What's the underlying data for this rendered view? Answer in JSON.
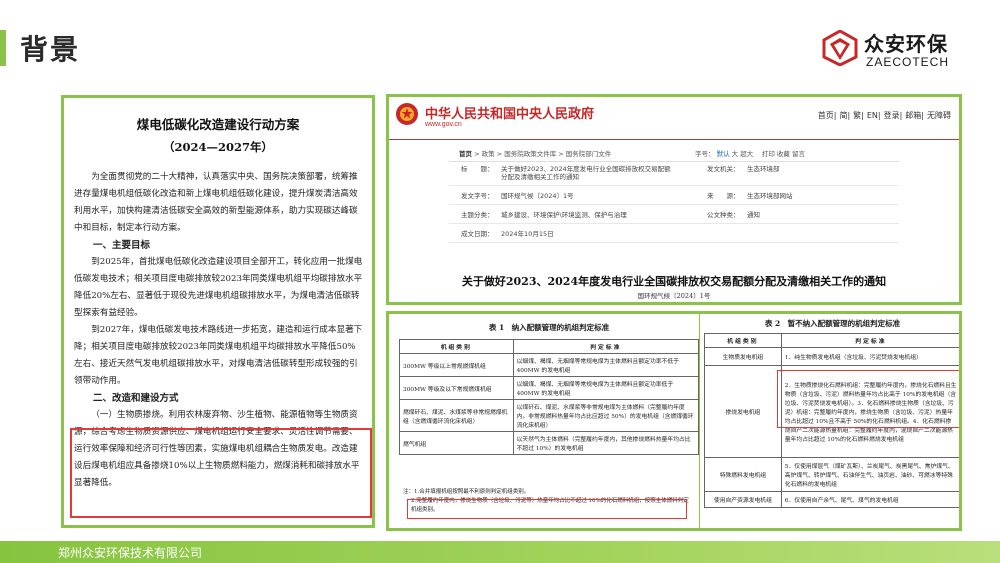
{
  "header": {
    "title": "背景",
    "logo_cn": "众安环保",
    "logo_en": "ZAECOTECH"
  },
  "footer": {
    "company": "郑州众安环保技术有限公司"
  },
  "colors": {
    "accent_green": "#8bc34a",
    "highlight_red": "#e53935",
    "gov_red": "#c62828"
  },
  "doc": {
    "title": "煤电低碳化改造建设行动方案",
    "subtitle": "（2024—2027年）",
    "para1": "为全面贯彻党的二十大精神，认真落实中央、国务院决策部署，统筹推进存量煤电机组低碳化改造和新上煤电机组低碳化建设，提升煤炭清洁高效利用水平，加快构建清洁低碳安全高效的新型能源体系，助力实现碳达峰碳中和目标，制定本行动方案。",
    "h1": "一、主要目标",
    "para2": "到2025年，首批煤电低碳化改造建设项目全部开工，转化应用一批煤电低碳发电技术；相关项目度电碳排放较2023年同类煤电机组平均碳排放水平降低20%左右、显著低于现役先进煤电机组碳排放水平，为煤电清洁低碳转型探索有益经验。",
    "para3": "到2027年，煤电低碳发电技术路线进一步拓宽，建造和运行成本显著下降；相关项目度电碳排放较2023年同类煤电机组平均碳排放水平降低50%左右、接近天然气发电机组碳排放水平，对煤电清洁低碳转型形成较强的引领带动作用。",
    "h2": "二、改造和建设方式",
    "para4": "（一）生物质掺烧。利用农林废弃物、沙生植物、能源植物等生物质资源，综合考虑生物质资源供应、煤电机组运行安全要求、灵活性调节需要、运行效率保障和经济可行性等因素，实施煤电机组耦合生物质发电。改造建设后煤电机组应具备掺烧10%以上生物质燃料能力，燃煤消耗和碳排放水平显著降低。"
  },
  "gov": {
    "site_name": "中华人民共和国中央人民政府",
    "url": "www.gov.cn",
    "nav": [
      "首页",
      "简",
      "繁",
      "EN",
      "登录",
      "邮箱",
      "无障碍"
    ],
    "breadcrumb": [
      "首页",
      "政策",
      "国务院政策文件库",
      "国务院部门文件"
    ],
    "tools_label": "字号：",
    "tools": [
      "默认",
      "大",
      "超大",
      "打印",
      "收藏",
      "留言"
    ],
    "meta": {
      "title_label": "标　　题：",
      "title_value": "关于做好2023、2024年度发电行业全国碳排放权交易配额分配及清缴相关工作的通知",
      "org_label": "发文机关：",
      "org_value": "生态环境部",
      "num_label": "发文字号：",
      "num_value": "国环规气候〔2024〕1号",
      "source_label": "来　　源：",
      "source_value": "生态环境部网站",
      "topic_label": "主题分类：",
      "topic_value": "城乡建设、环境保护\\环境监测、保护与治理",
      "type_label": "公文种类：",
      "type_value": "通知",
      "date_label": "成文日期：",
      "date_value": "2024年10月15日"
    },
    "doc_title": "关于做好2023、2024年度发电行业全国碳排放权交易配额分配及清缴相关工作的通知",
    "doc_num": "国环规气候〔2024〕1号"
  },
  "table1": {
    "caption": "表 1　纳入配额管理的机组判定标准",
    "headers": [
      "机组类别",
      "判定标准"
    ],
    "rows": [
      [
        "300MW 等级以上常规燃煤机组",
        "以烟煤、褐煤、无烟煤等常规电煤为主体燃料且额定功率不低于 400MW 的发电机组"
      ],
      [
        "300MW 等级及以下常规燃煤机组",
        "以烟煤、褐煤、无烟煤等常规电煤为主体燃料且额定功率低于 400MW 的发电机组"
      ],
      [
        "燃煤矸石、煤泥、水煤浆等非常规燃煤机组（含燃煤循环流化床机组）",
        "以煤矸石、煤泥、水煤浆等非常规电煤为主体燃料（完整履约年度内，非常规燃料热量年均占比应超过 50%）的发电机组（含燃煤循环流化床机组）"
      ],
      [
        "燃气机组",
        "以天然气为主体燃料（完整履约年度内，其他掺烧燃料热量年均占比不超过 10%）的发电机组"
      ]
    ],
    "note1": "注：1.合并填报机组按照最不利原则判定机组类别。",
    "note2": "2.完整履约年度内，掺烧生物质（含垃圾、污泥等）热量年均占比不超过 10%的化石燃料机组，按照主体燃料判定机组类别。"
  },
  "table2": {
    "caption": "表 2　暂不纳入配额管理的机组判定标准",
    "headers": [
      "机组类别",
      "判定标准"
    ],
    "rows": [
      [
        "生物质发电机组",
        "1．纯生物质发电机组（含垃圾、污泥焚烧发电机组）"
      ],
      [
        "掺烧发电机组",
        "2．生物质掺烧化石燃料机组：完整履约年度内，掺烧化石燃料且生物质（含垃圾、污泥）燃料热量年均占比高于 10%的发电机组（含垃圾、污泥焚烧发电机组）。3．化石燃料掺烧生物质（含垃圾、污泥）机组：完整履约年度内，掺烧生物质（含垃圾、污泥）热量年均占比超过 10%且不高于 50%的化石燃料机组。4．化石燃料掺烧自产二次能源热量机组：完整履约年度内，混烧自产二次能源热量年均占比超过 10%的化石燃料燃烧发电机组"
      ],
      [
        "特殊燃料发电机组",
        "5．仅使用煤层气（煤矿瓦斯）、兰炭尾气、炭黑尾气、焦炉煤气、高炉煤气、转炉煤气、石油伴生气、油页岩、油砂、可燃冰等特殊化石燃料的发电机组"
      ],
      [
        "使用自产资源发电机组",
        "6．仅使用自产余气、尾气、煤气的发电机组"
      ]
    ]
  }
}
